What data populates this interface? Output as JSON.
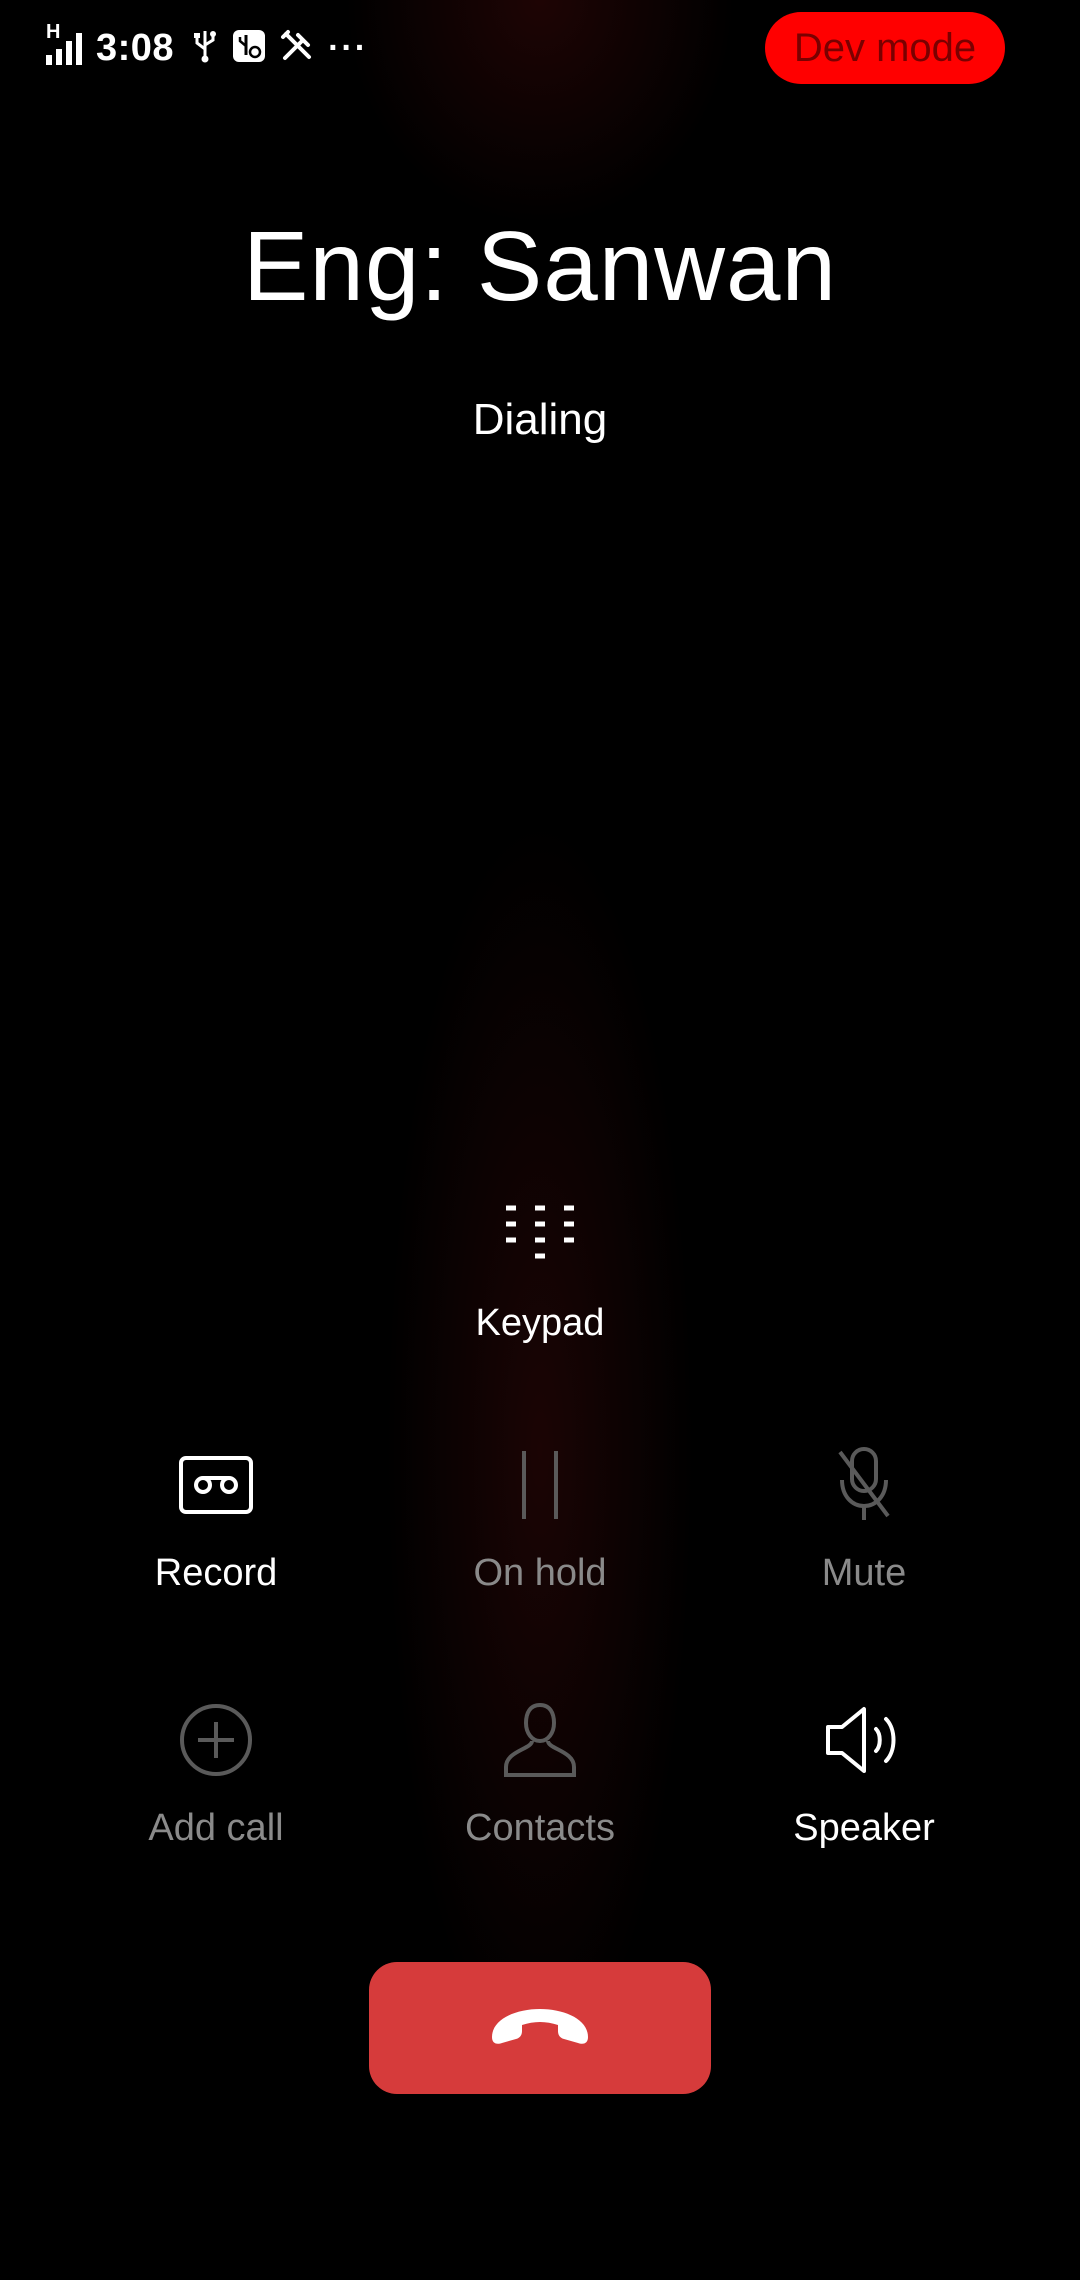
{
  "status_bar": {
    "network_type": "H",
    "time": "3:08",
    "icons": [
      "signal-icon",
      "usb-icon",
      "usb-debug-icon",
      "developer-tools-icon",
      "more-notifications-icon"
    ],
    "overflow": "···"
  },
  "dev_mode": {
    "label": "Dev mode",
    "color": "#ff0000"
  },
  "call": {
    "caller_name": "Eng: Sanwan",
    "status": "Dialing"
  },
  "controls": {
    "keypad": {
      "label": "Keypad",
      "icon": "dialpad-icon",
      "enabled": true
    },
    "record": {
      "label": "Record",
      "icon": "cassette-icon",
      "enabled": true
    },
    "on_hold": {
      "label": "On hold",
      "icon": "pause-icon",
      "enabled": false
    },
    "mute": {
      "label": "Mute",
      "icon": "mic-off-icon",
      "enabled": false
    },
    "add_call": {
      "label": "Add call",
      "icon": "plus-circle-icon",
      "enabled": false
    },
    "contacts": {
      "label": "Contacts",
      "icon": "person-icon",
      "enabled": false
    },
    "speaker": {
      "label": "Speaker",
      "icon": "speaker-icon",
      "enabled": true
    }
  },
  "end_call": {
    "icon": "hang-up-icon",
    "color": "#d63b3b"
  },
  "colors": {
    "background": "#000000",
    "enabled_text": "#ffffff",
    "disabled_text": "#8a8a8a"
  }
}
